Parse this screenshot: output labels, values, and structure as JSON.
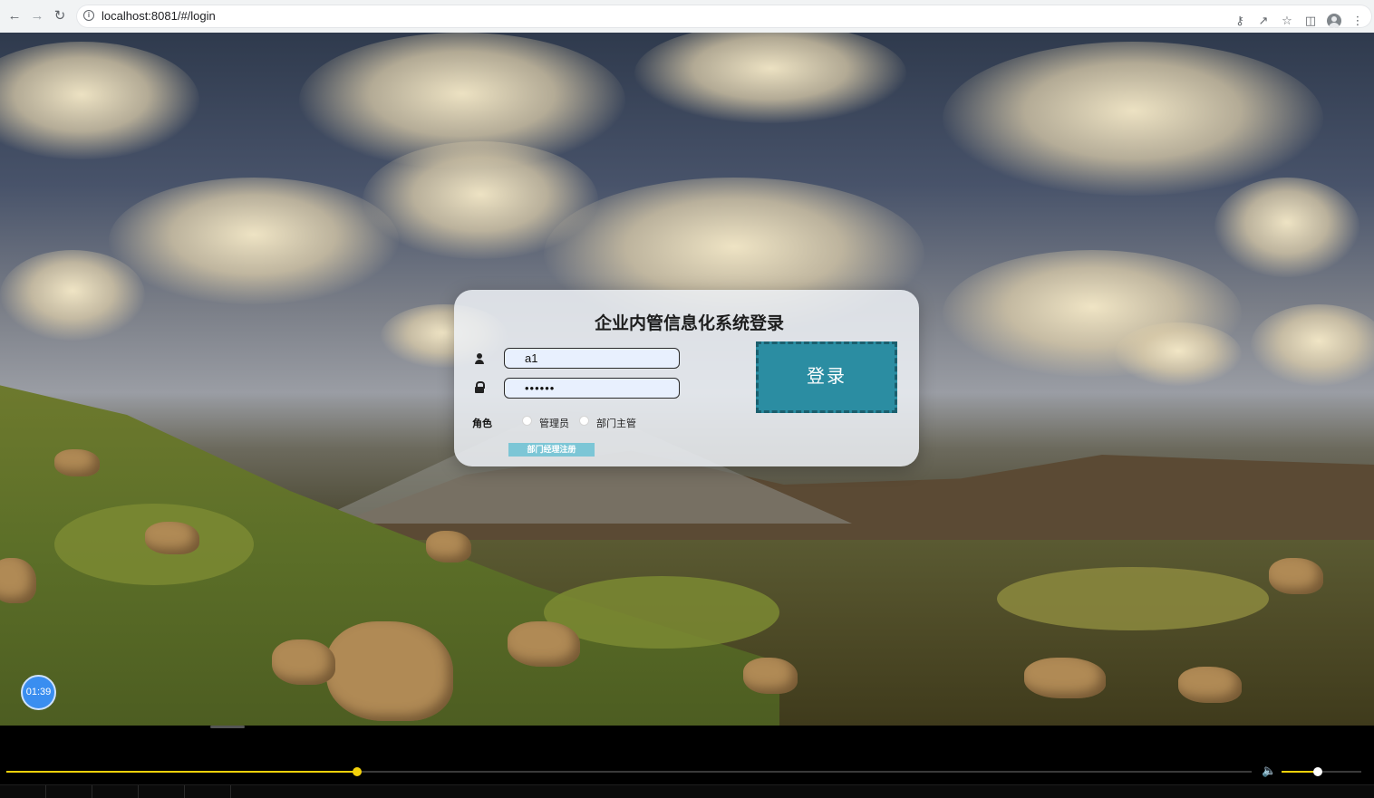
{
  "browser": {
    "url": "localhost:8081/#/login",
    "icons": {
      "back": "arrow-left-icon",
      "forward": "arrow-right-icon",
      "reload": "reload-icon",
      "info": "info-icon",
      "key": "key-icon",
      "share": "share-icon",
      "bookmark": "star-icon",
      "sidepanel": "side-panel-icon",
      "profile": "profile-icon",
      "menu": "kebab-menu-icon"
    }
  },
  "login": {
    "title": "企业内管信息化系统登录",
    "username_value": "a1",
    "password_value": "••••••",
    "role_label": "角色",
    "roles": [
      "管理员",
      "部门主管"
    ],
    "register_label": "部门经理注册",
    "login_label": "登录",
    "colors": {
      "login_button": "#2b8da2",
      "register_button": "#7cc6d6"
    }
  },
  "timer": "01:39",
  "player": {
    "progress": 0.282,
    "volume": 0.45,
    "accent": "#f3d10a"
  }
}
